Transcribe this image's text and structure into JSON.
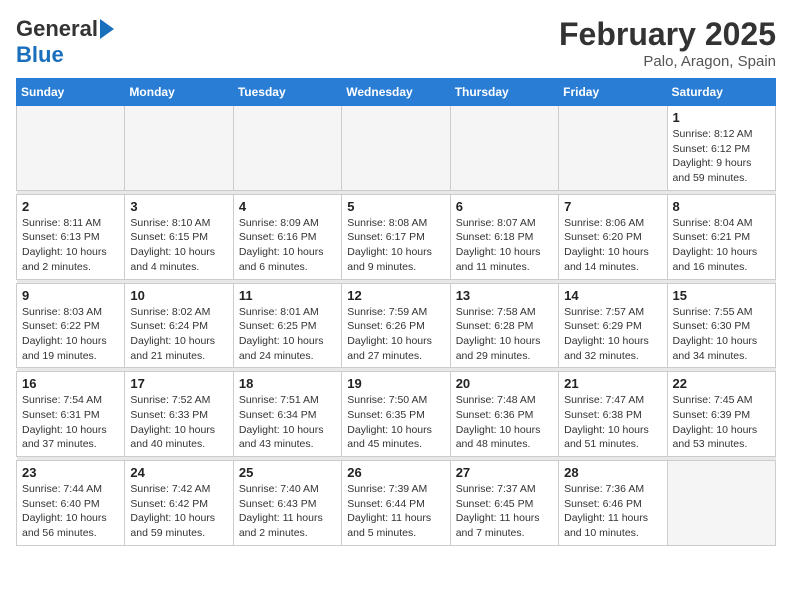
{
  "header": {
    "logo_line1": "General",
    "logo_line2": "Blue",
    "month": "February 2025",
    "location": "Palo, Aragon, Spain"
  },
  "weekdays": [
    "Sunday",
    "Monday",
    "Tuesday",
    "Wednesday",
    "Thursday",
    "Friday",
    "Saturday"
  ],
  "weeks": [
    [
      {
        "day": "",
        "info": ""
      },
      {
        "day": "",
        "info": ""
      },
      {
        "day": "",
        "info": ""
      },
      {
        "day": "",
        "info": ""
      },
      {
        "day": "",
        "info": ""
      },
      {
        "day": "",
        "info": ""
      },
      {
        "day": "1",
        "info": "Sunrise: 8:12 AM\nSunset: 6:12 PM\nDaylight: 9 hours\nand 59 minutes."
      }
    ],
    [
      {
        "day": "2",
        "info": "Sunrise: 8:11 AM\nSunset: 6:13 PM\nDaylight: 10 hours\nand 2 minutes."
      },
      {
        "day": "3",
        "info": "Sunrise: 8:10 AM\nSunset: 6:15 PM\nDaylight: 10 hours\nand 4 minutes."
      },
      {
        "day": "4",
        "info": "Sunrise: 8:09 AM\nSunset: 6:16 PM\nDaylight: 10 hours\nand 6 minutes."
      },
      {
        "day": "5",
        "info": "Sunrise: 8:08 AM\nSunset: 6:17 PM\nDaylight: 10 hours\nand 9 minutes."
      },
      {
        "day": "6",
        "info": "Sunrise: 8:07 AM\nSunset: 6:18 PM\nDaylight: 10 hours\nand 11 minutes."
      },
      {
        "day": "7",
        "info": "Sunrise: 8:06 AM\nSunset: 6:20 PM\nDaylight: 10 hours\nand 14 minutes."
      },
      {
        "day": "8",
        "info": "Sunrise: 8:04 AM\nSunset: 6:21 PM\nDaylight: 10 hours\nand 16 minutes."
      }
    ],
    [
      {
        "day": "9",
        "info": "Sunrise: 8:03 AM\nSunset: 6:22 PM\nDaylight: 10 hours\nand 19 minutes."
      },
      {
        "day": "10",
        "info": "Sunrise: 8:02 AM\nSunset: 6:24 PM\nDaylight: 10 hours\nand 21 minutes."
      },
      {
        "day": "11",
        "info": "Sunrise: 8:01 AM\nSunset: 6:25 PM\nDaylight: 10 hours\nand 24 minutes."
      },
      {
        "day": "12",
        "info": "Sunrise: 7:59 AM\nSunset: 6:26 PM\nDaylight: 10 hours\nand 27 minutes."
      },
      {
        "day": "13",
        "info": "Sunrise: 7:58 AM\nSunset: 6:28 PM\nDaylight: 10 hours\nand 29 minutes."
      },
      {
        "day": "14",
        "info": "Sunrise: 7:57 AM\nSunset: 6:29 PM\nDaylight: 10 hours\nand 32 minutes."
      },
      {
        "day": "15",
        "info": "Sunrise: 7:55 AM\nSunset: 6:30 PM\nDaylight: 10 hours\nand 34 minutes."
      }
    ],
    [
      {
        "day": "16",
        "info": "Sunrise: 7:54 AM\nSunset: 6:31 PM\nDaylight: 10 hours\nand 37 minutes."
      },
      {
        "day": "17",
        "info": "Sunrise: 7:52 AM\nSunset: 6:33 PM\nDaylight: 10 hours\nand 40 minutes."
      },
      {
        "day": "18",
        "info": "Sunrise: 7:51 AM\nSunset: 6:34 PM\nDaylight: 10 hours\nand 43 minutes."
      },
      {
        "day": "19",
        "info": "Sunrise: 7:50 AM\nSunset: 6:35 PM\nDaylight: 10 hours\nand 45 minutes."
      },
      {
        "day": "20",
        "info": "Sunrise: 7:48 AM\nSunset: 6:36 PM\nDaylight: 10 hours\nand 48 minutes."
      },
      {
        "day": "21",
        "info": "Sunrise: 7:47 AM\nSunset: 6:38 PM\nDaylight: 10 hours\nand 51 minutes."
      },
      {
        "day": "22",
        "info": "Sunrise: 7:45 AM\nSunset: 6:39 PM\nDaylight: 10 hours\nand 53 minutes."
      }
    ],
    [
      {
        "day": "23",
        "info": "Sunrise: 7:44 AM\nSunset: 6:40 PM\nDaylight: 10 hours\nand 56 minutes."
      },
      {
        "day": "24",
        "info": "Sunrise: 7:42 AM\nSunset: 6:42 PM\nDaylight: 10 hours\nand 59 minutes."
      },
      {
        "day": "25",
        "info": "Sunrise: 7:40 AM\nSunset: 6:43 PM\nDaylight: 11 hours\nand 2 minutes."
      },
      {
        "day": "26",
        "info": "Sunrise: 7:39 AM\nSunset: 6:44 PM\nDaylight: 11 hours\nand 5 minutes."
      },
      {
        "day": "27",
        "info": "Sunrise: 7:37 AM\nSunset: 6:45 PM\nDaylight: 11 hours\nand 7 minutes."
      },
      {
        "day": "28",
        "info": "Sunrise: 7:36 AM\nSunset: 6:46 PM\nDaylight: 11 hours\nand 10 minutes."
      },
      {
        "day": "",
        "info": ""
      }
    ]
  ]
}
